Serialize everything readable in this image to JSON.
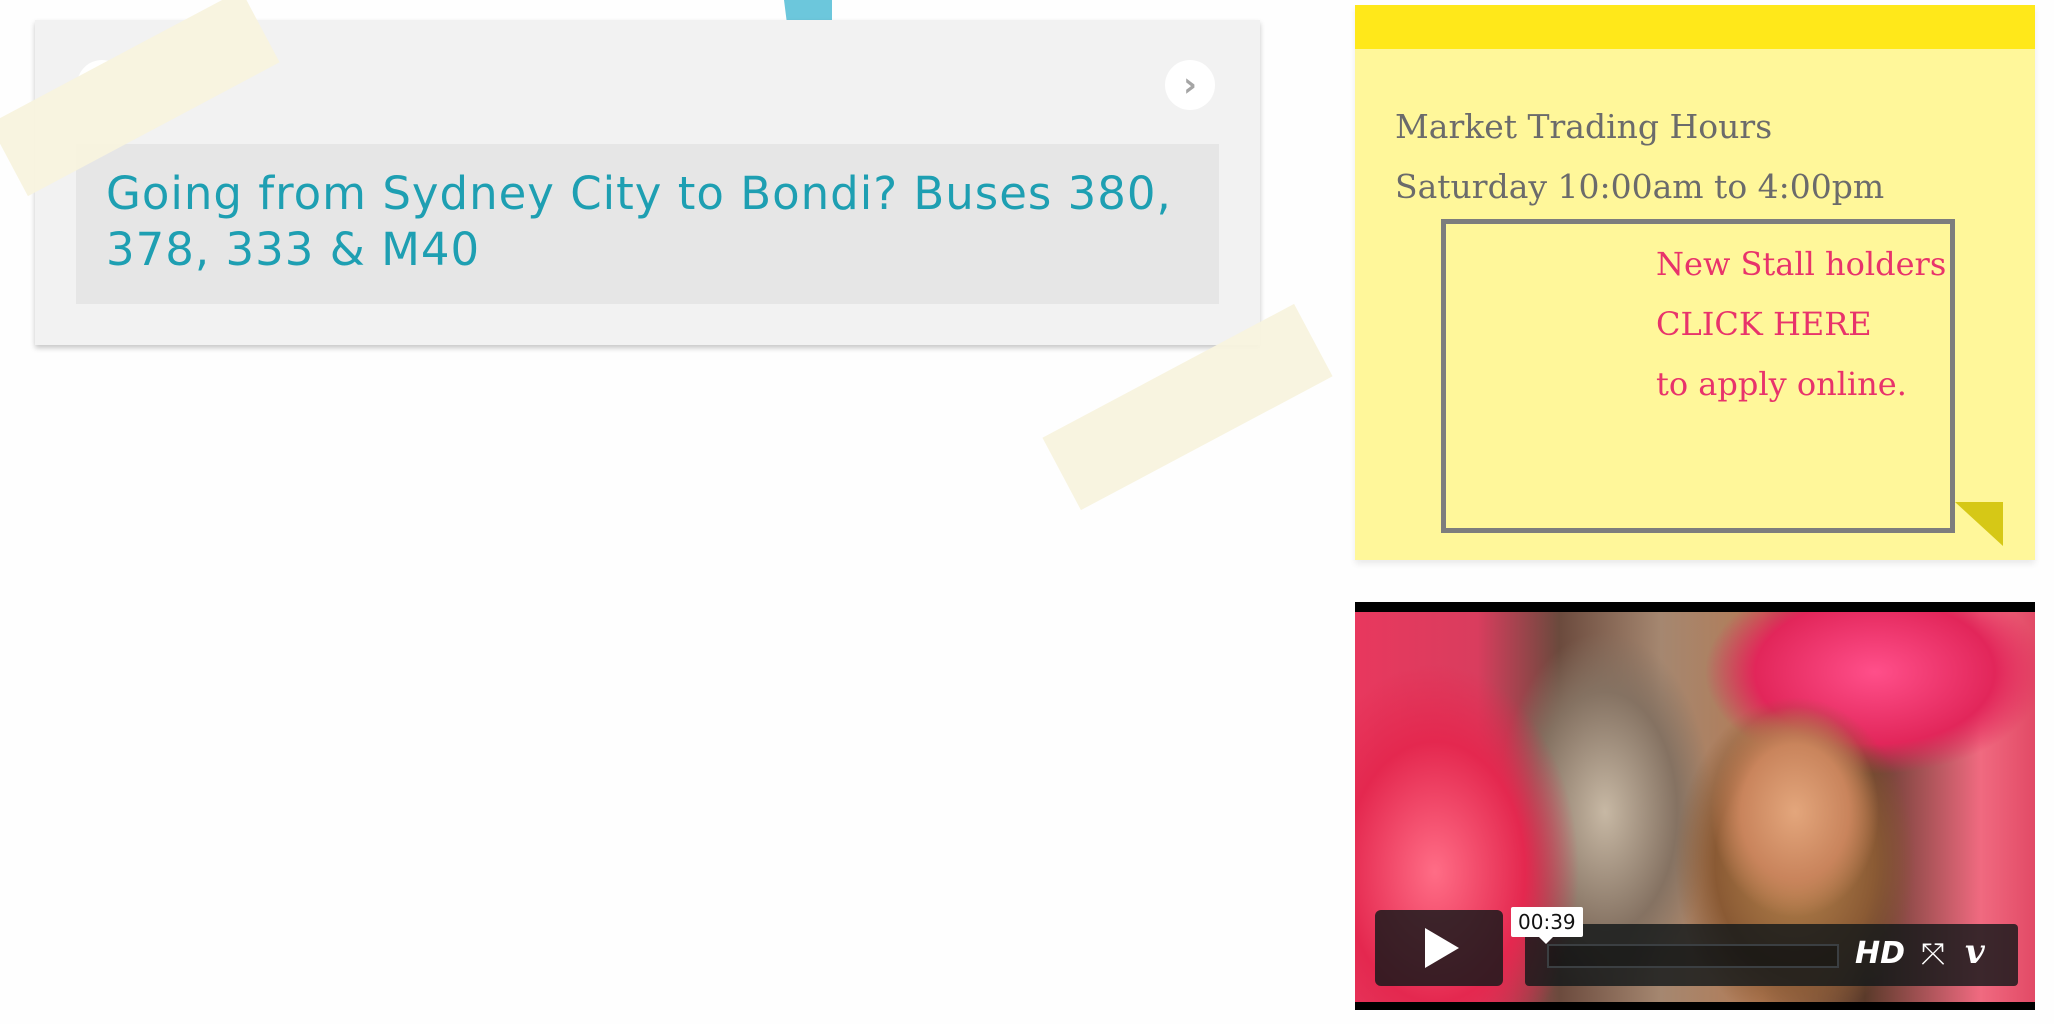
{
  "slider": {
    "slide_text": "Going from Sydney City to Bondi? Buses 380, 378, 333 & M40",
    "next_glyph": "›"
  },
  "sticky_note": {
    "title": "Market Trading Hours",
    "hours": "Saturday 10:00am to 4:00pm",
    "stall_line_1": "New Stall holders",
    "stall_line_2": "CLICK HERE",
    "stall_line_3": "to apply online."
  },
  "video": {
    "time_tooltip": "00:39",
    "hd_label": "HD",
    "fullscreen_glyph": "⤧",
    "vimeo_label": "v",
    "icons": [
      "play-icon",
      "fullscreen-icon",
      "vimeo-logo-icon"
    ]
  },
  "colors": {
    "slide_text": "#1e9fb2",
    "sticky_bg": "#fff79a",
    "sticky_top": "#ffe81a",
    "stall_text": "#e8336b",
    "hours_text": "#6b6b6b"
  }
}
